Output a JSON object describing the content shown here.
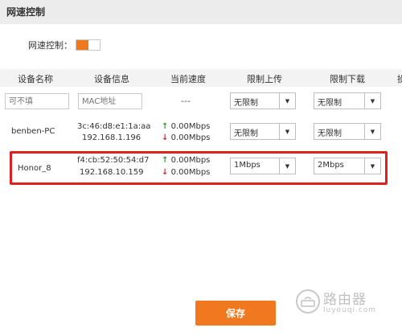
{
  "header": {
    "title": "网速控制"
  },
  "toggle": {
    "label": "网速控制：",
    "state": "on",
    "accent": "#f0781e"
  },
  "table": {
    "columns": [
      "设备名称",
      "设备信息",
      "当前速度",
      "限制上传",
      "限制下载",
      "操"
    ],
    "new_row": {
      "name_placeholder": "可不填",
      "mac_placeholder": "MAC地址",
      "speed": "---",
      "upload": "无限制",
      "download": "无限制"
    },
    "rows": [
      {
        "name": "benben-PC",
        "mac": "3c:46:d8:e1:1a:aa",
        "ip": "192.168.1.196",
        "up_speed": "0.00Mbps",
        "down_speed": "0.00Mbps",
        "upload": "无限制",
        "download": "无限制"
      },
      {
        "name": "Honor_8",
        "mac": "f4:cb:52:50:54:d7",
        "ip": "192.168.10.159",
        "up_speed": "0.00Mbps",
        "down_speed": "0.00Mbps",
        "upload": "1Mbps",
        "download": "2Mbps"
      }
    ]
  },
  "save_label": "保存",
  "watermark": {
    "cn": "路由器",
    "en": "luyouqi.com"
  },
  "colors": {
    "highlight": "#e0201f",
    "up_arrow": "#2c9c2c",
    "down_arrow": "#d9262c"
  }
}
